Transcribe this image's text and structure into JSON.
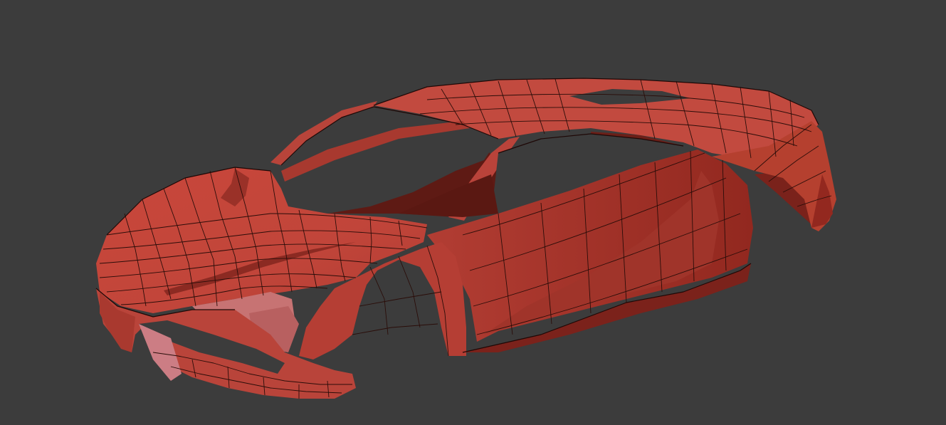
{
  "viewport": {
    "background_color": "#3c3c3c",
    "object": "car-body-wireframe-mesh",
    "shading": "flat-with-edges",
    "colors": {
      "base": "#c4493e",
      "light": "#d35b4f",
      "mid": "#b53f35",
      "dark": "#8d2a22",
      "darker": "#6a1e18",
      "highlight": "#c88080",
      "edge": "#2a0d09"
    }
  }
}
